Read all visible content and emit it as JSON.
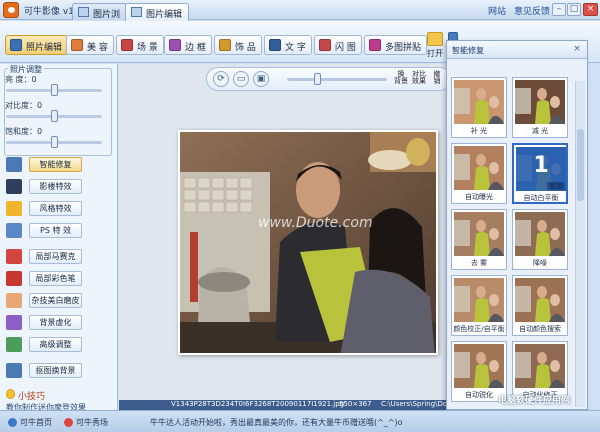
{
  "app": {
    "title": "可牛影像 v1.9.4.1001",
    "tabs": [
      {
        "label": "图片浏"
      },
      {
        "label": "图片编辑"
      }
    ],
    "links": {
      "website": "网站",
      "feedback": "意见反馈"
    }
  },
  "toolbar": {
    "buttons": [
      {
        "label": "照片编辑",
        "color": "#3a6fb6"
      },
      {
        "label": "美 容",
        "color": "#e07b39"
      },
      {
        "label": "场 景",
        "color": "#c94444"
      },
      {
        "label": "边 框",
        "color": "#9b4fb0"
      },
      {
        "label": "饰 品",
        "color": "#d29a2b"
      },
      {
        "label": "文 字",
        "color": "#2f5d9c"
      },
      {
        "label": "闪 图",
        "color": "#c34a4a"
      },
      {
        "label": "多图拼贴",
        "color": "#c03a8e"
      }
    ],
    "open_label": "打开",
    "save_label": "保"
  },
  "left": {
    "section_title": "照片调整",
    "sliders": [
      {
        "label": "亮  度：",
        "value": "0",
        "level": 0.5
      },
      {
        "label": "对比度：",
        "value": "0",
        "level": 0.5
      },
      {
        "label": "饱和度：",
        "value": "0",
        "level": 0.5
      }
    ],
    "menu": [
      {
        "label": "智能修复",
        "icon": "magic-icon",
        "color": "#4a79b6"
      },
      {
        "label": "影楼特效",
        "icon": "camera-icon",
        "color": "#2d3f5c"
      },
      {
        "label": "风格特效",
        "icon": "sun-icon",
        "color": "#f0b52a"
      },
      {
        "label": "PS 特 效",
        "icon": "brush-icon",
        "color": "#5a88c4"
      },
      {
        "label": "局部马赛克",
        "icon": "heart-icon",
        "color": "#d2463f"
      },
      {
        "label": "局部彩色笔",
        "icon": "pen-icon",
        "color": "#c6382f"
      },
      {
        "label": "杂技美白磨皮",
        "icon": "face-icon",
        "color": "#e7a777"
      },
      {
        "label": "背景虚化",
        "icon": "palette-icon",
        "color": "#8b5fc7"
      },
      {
        "label": "高级调整",
        "icon": "tools-icon",
        "color": "#4c9c5a"
      },
      {
        "label": "抠图换背景",
        "icon": "scissors-icon",
        "color": "#4b7ab2"
      }
    ],
    "tips_title": "小技巧",
    "tips_text": "教你制作迷你摩登效果"
  },
  "canvas": {
    "zoom": {
      "level": 0.3
    },
    "buttons": [
      {
        "label": "换\n背景"
      },
      {
        "label": "对比\n效果"
      },
      {
        "label": "撤\n销"
      }
    ],
    "watermark_text": "www.Duote.com",
    "status": {
      "filename": "V1343P28T3D234T0I6F3268T20090117I1921.jpg",
      "dimensions": "550×367",
      "path": "C:\\Users\\Spring\\Documents..."
    }
  },
  "right": {
    "title": "智能修复",
    "close": "×",
    "tiles": [
      {
        "label": "补  光",
        "tone": "#c99670"
      },
      {
        "label": "减  光",
        "tone": "#6c4b38"
      },
      {
        "label": "自动曝光",
        "tone": "#b38160"
      },
      {
        "label": "自动白平衡",
        "tone": "#3b6fb8",
        "badge_number": "1",
        "badge": "撤销"
      },
      {
        "label": "去  雾",
        "tone": "#a57d60"
      },
      {
        "label": "降噪",
        "tone": "#8e6c53"
      },
      {
        "label": "颜色校正/自平衡",
        "tone": "#b88c6b"
      },
      {
        "label": "自动颜色搜索",
        "tone": "#9b7254"
      },
      {
        "label": "自动锐化",
        "tone": "#a07656"
      },
      {
        "label": "自动化修正",
        "tone": "#8d6a51"
      }
    ]
  },
  "bottom": {
    "items": [
      {
        "label": "可牛首页",
        "color": "#3d79c9"
      },
      {
        "label": "可牛秀场",
        "color": "#d8463f"
      }
    ],
    "ticker": "牛牛达人活动开始啦，秀出最真最美的你，还有大量牛币赠送哦(^_^)o"
  },
  "overlay_watermark": "电脑软硬件应用网"
}
